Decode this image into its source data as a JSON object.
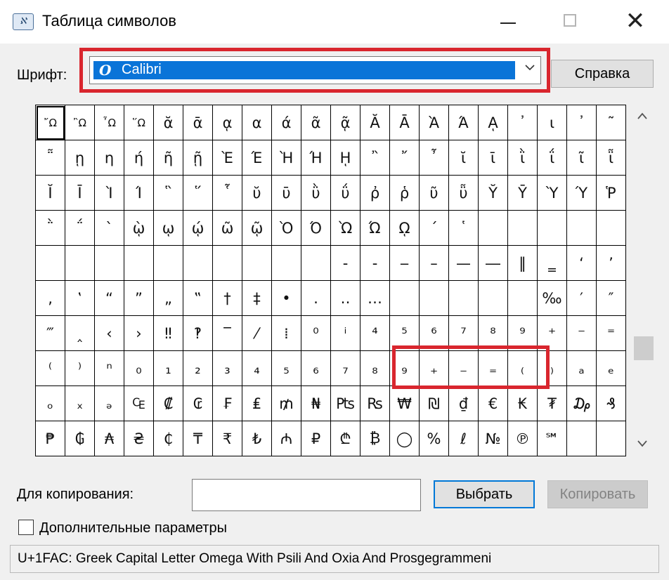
{
  "window": {
    "title": "Таблица символов",
    "minimize_glyph": "",
    "maximize_glyph": "",
    "close_glyph": "✕"
  },
  "font": {
    "label": "Шрифт:",
    "value": "Calibri",
    "icon_glyph": "O"
  },
  "help_button": "Справка",
  "grid": {
    "rows": [
      [
        "῎Ω",
        "῍Ω",
        "῏Ω",
        "῞Ω",
        "ᾰ",
        "ᾱ",
        "ᾳ",
        "α",
        "ά",
        "ᾶ",
        "ᾷ",
        "Ᾰ",
        "Ᾱ",
        "Ὰ",
        "Ά",
        "ᾼ",
        "᾽",
        "ι",
        "᾿",
        "῀"
      ],
      [
        "῁",
        "ῃ",
        "η",
        "ή",
        "ῆ",
        "ῇ",
        "Ὲ",
        "Έ",
        "Ὴ",
        "Ή",
        "ῌ",
        "῍",
        "῎",
        "῏",
        "ῐ",
        "ῑ",
        "ῒ",
        "ΐ",
        "ῖ",
        "ῗ"
      ],
      [
        "Ῐ",
        "Ῑ",
        "Ὶ",
        "Ί",
        "῝",
        "῞",
        "῟",
        "ῠ",
        "ῡ",
        "ῢ",
        "ΰ",
        "ῤ",
        "ῥ",
        "ῦ",
        "ῧ",
        "Ῠ",
        "Ῡ",
        "Ὺ",
        "Ύ",
        "Ῥ"
      ],
      [
        "῭",
        "΅",
        "`",
        "ῲ",
        "ῳ",
        "ῴ",
        "ῶ",
        "ῷ",
        "Ὸ",
        "Ό",
        "Ὼ",
        "Ώ",
        "ῼ",
        "´",
        "῾",
        "",
        "",
        "",
        "",
        ""
      ],
      [
        "",
        "",
        "",
        "",
        "",
        "",
        "",
        "",
        "",
        "",
        "‐",
        "‑",
        "‒",
        "–",
        "—",
        "―",
        "‖",
        "‗",
        "‘",
        "’"
      ],
      [
        "‚",
        "‛",
        "“",
        "”",
        "„",
        "‟",
        "†",
        "‡",
        "•",
        "․",
        "‥",
        "…",
        "",
        "",
        "",
        "",
        "",
        "‰",
        "′",
        "″"
      ],
      [
        "‴",
        "‸",
        "‹",
        "›",
        "‼",
        "‽",
        "‾",
        "⁄",
        "⁞",
        "⁰",
        "ⁱ",
        "⁴",
        "⁵",
        "⁶",
        "⁷",
        "⁸",
        "⁹",
        "⁺",
        "⁻",
        "⁼"
      ],
      [
        "⁽",
        "⁾",
        "ⁿ",
        "₀",
        "₁",
        "₂",
        "₃",
        "₄",
        "₅",
        "₆",
        "₇",
        "₈",
        "₉",
        "₊",
        "₋",
        "₌",
        "₍",
        "₎",
        "ₐ",
        "ₑ"
      ],
      [
        "ₒ",
        "ₓ",
        "ₔ",
        "₠",
        "₡",
        "₢",
        "₣",
        "₤",
        "₥",
        "₦",
        "₧",
        "₨",
        "₩",
        "₪",
        "₫",
        "€",
        "₭",
        "₮",
        "₯",
        "₰"
      ],
      [
        "₱",
        "₲",
        "₳",
        "₴",
        "₵",
        "₸",
        "₹",
        "₺",
        "₼",
        "₽",
        "₾",
        "₿",
        "◯",
        "%",
        "ℓ",
        "№",
        "℗",
        "℠",
        "",
        ""
      ]
    ],
    "selected_symbol": "῎Ω"
  },
  "copy": {
    "label": "Для копирования:",
    "value": "",
    "select_button": "Выбрать",
    "copy_button": "Копировать"
  },
  "advanced": {
    "label": "Дополнительные параметры",
    "checked": false
  },
  "status": {
    "text": "U+1FAC: Greek Capital Letter Omega With Psili And Oxia And Prosgegrammeni"
  },
  "colors": {
    "highlight_red": "#d9262e",
    "selection_blue": "#0a74d8",
    "default_button_border": "#0078d7"
  }
}
